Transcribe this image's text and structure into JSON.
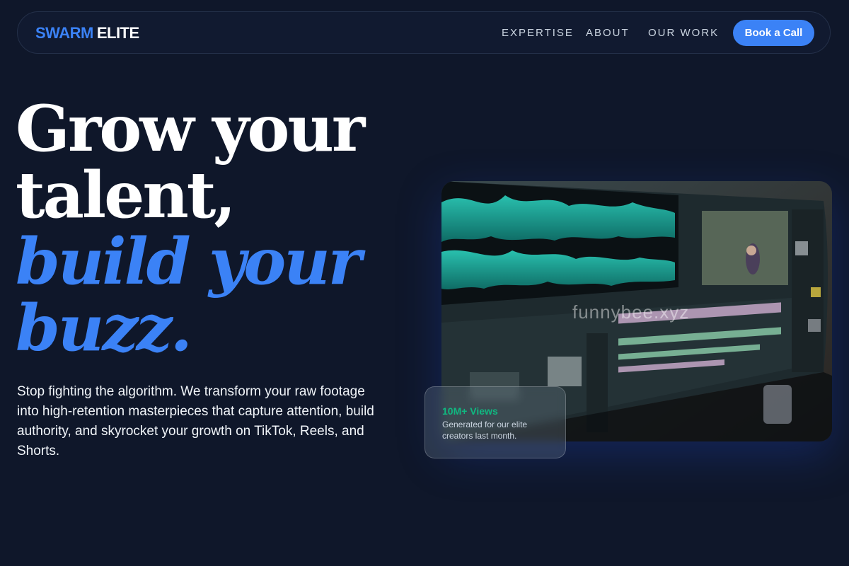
{
  "brand": {
    "part1": "SWARM",
    "part2": "ELITE"
  },
  "nav": {
    "links": [
      "EXPERTISE",
      "ABOUT",
      "OUR WORK"
    ],
    "cta": "Book a Call"
  },
  "hero": {
    "line1": "Grow your",
    "line2": "talent,",
    "line3": "build your",
    "line4": "buzz.",
    "subtitle": "Stop fighting the algorithm. We transform your raw footage into high-retention masterpieces that capture attention, build authority, and skyrocket your growth on TikTok, Reels, and Shorts."
  },
  "media": {
    "watermark": "funnybee.xyz"
  },
  "stat": {
    "value": "10M+ Views",
    "description": "Generated for our elite creators last month."
  },
  "colors": {
    "background": "#0f172a",
    "accent": "#3b82f6",
    "stat_green": "#10b981"
  }
}
